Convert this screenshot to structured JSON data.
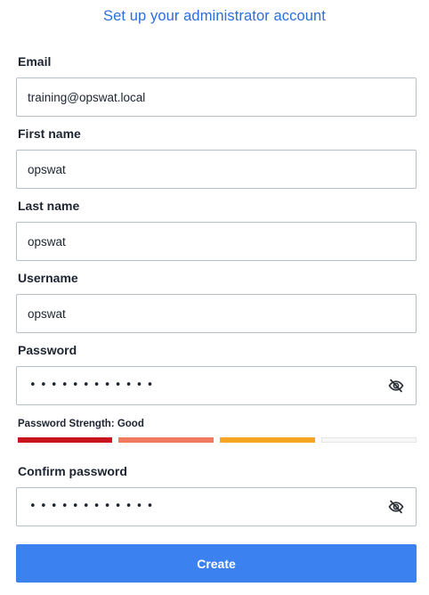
{
  "page": {
    "title": "Set up your administrator account"
  },
  "form": {
    "email": {
      "label": "Email",
      "value": "training@opswat.local"
    },
    "first_name": {
      "label": "First name",
      "value": "opswat"
    },
    "last_name": {
      "label": "Last name",
      "value": "opswat"
    },
    "username": {
      "label": "Username",
      "value": "opswat"
    },
    "password": {
      "label": "Password",
      "masked_value": "••••••••••••",
      "toggle_icon": "eye-slash-icon"
    },
    "password_strength": {
      "label": "Password Strength: Good",
      "segments_total": 4,
      "segments_filled": 3,
      "colors": [
        "#c8141c",
        "#f07a5d",
        "#f5a623",
        "#f2f2f2"
      ]
    },
    "confirm_password": {
      "label": "Confirm password",
      "masked_value": "••••••••••••",
      "toggle_icon": "eye-slash-icon"
    },
    "submit_label": "Create"
  },
  "colors": {
    "accent": "#3b82f0",
    "title": "#2a6fdb",
    "border": "#b9bfc9"
  }
}
